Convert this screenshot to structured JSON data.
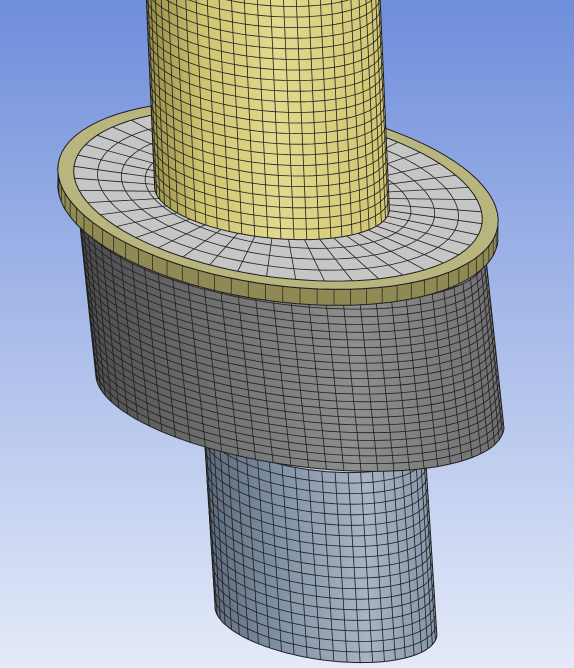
{
  "viewport": {
    "name": "mesh-graphics-view",
    "background": {
      "top": "#6f8edb",
      "bottom": "#e4eaf8"
    }
  },
  "colors": {
    "upper_rod": {
      "light": "#e2d98d",
      "mid": "#cfc470",
      "dark": "#8e8542"
    },
    "flange_ring": {
      "face": "#b9b57e",
      "edge": "#8f8a54"
    },
    "flange_top": {
      "face": "#c6c6c6",
      "shade": "#a6a6a6"
    },
    "body_cylinder": {
      "light": "#8e8e8e",
      "mid": "#6e6e6e",
      "dark": "#4a4a4a"
    },
    "lower_rod": {
      "light": "#a8b4c3",
      "mid": "#8494a8",
      "dark": "#596779"
    },
    "mesh_line": "#1f1f1f"
  },
  "parts": [
    {
      "id": "upper-rod",
      "label": ""
    },
    {
      "id": "flange",
      "label": ""
    },
    {
      "id": "body-cylinder",
      "label": ""
    },
    {
      "id": "lower-rod",
      "label": ""
    }
  ]
}
